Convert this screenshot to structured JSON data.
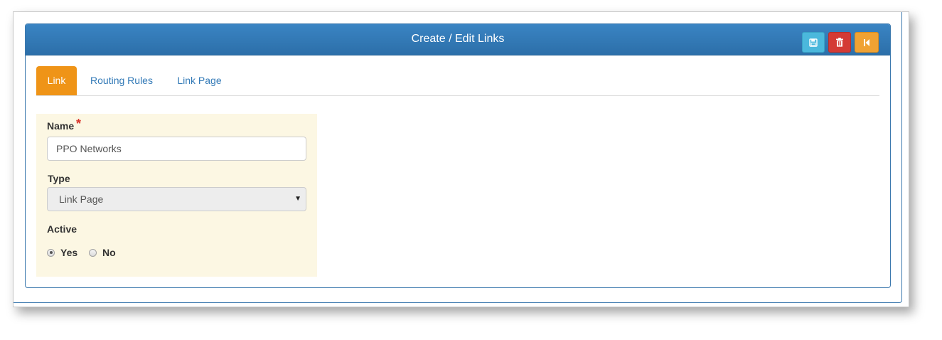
{
  "panel": {
    "title": "Create / Edit Links"
  },
  "toolbar": {
    "save_icon": "floppy-disk-icon",
    "delete_icon": "trash-icon",
    "back_icon": "step-backward-icon",
    "colors": {
      "header": "#2f75b1",
      "save": "#4bb8dc",
      "delete": "#d43a35",
      "back": "#f0a233"
    }
  },
  "tabs": [
    {
      "label": "Link",
      "active": true
    },
    {
      "label": "Routing Rules",
      "active": false
    },
    {
      "label": "Link Page",
      "active": false
    }
  ],
  "form": {
    "name_label": "Name",
    "required_mark": "*",
    "name_value": "PPO Networks",
    "type_label": "Type",
    "type_value": "Link Page",
    "active_label": "Active",
    "active_options": [
      {
        "label": "Yes",
        "checked": true
      },
      {
        "label": "No",
        "checked": false
      }
    ]
  }
}
